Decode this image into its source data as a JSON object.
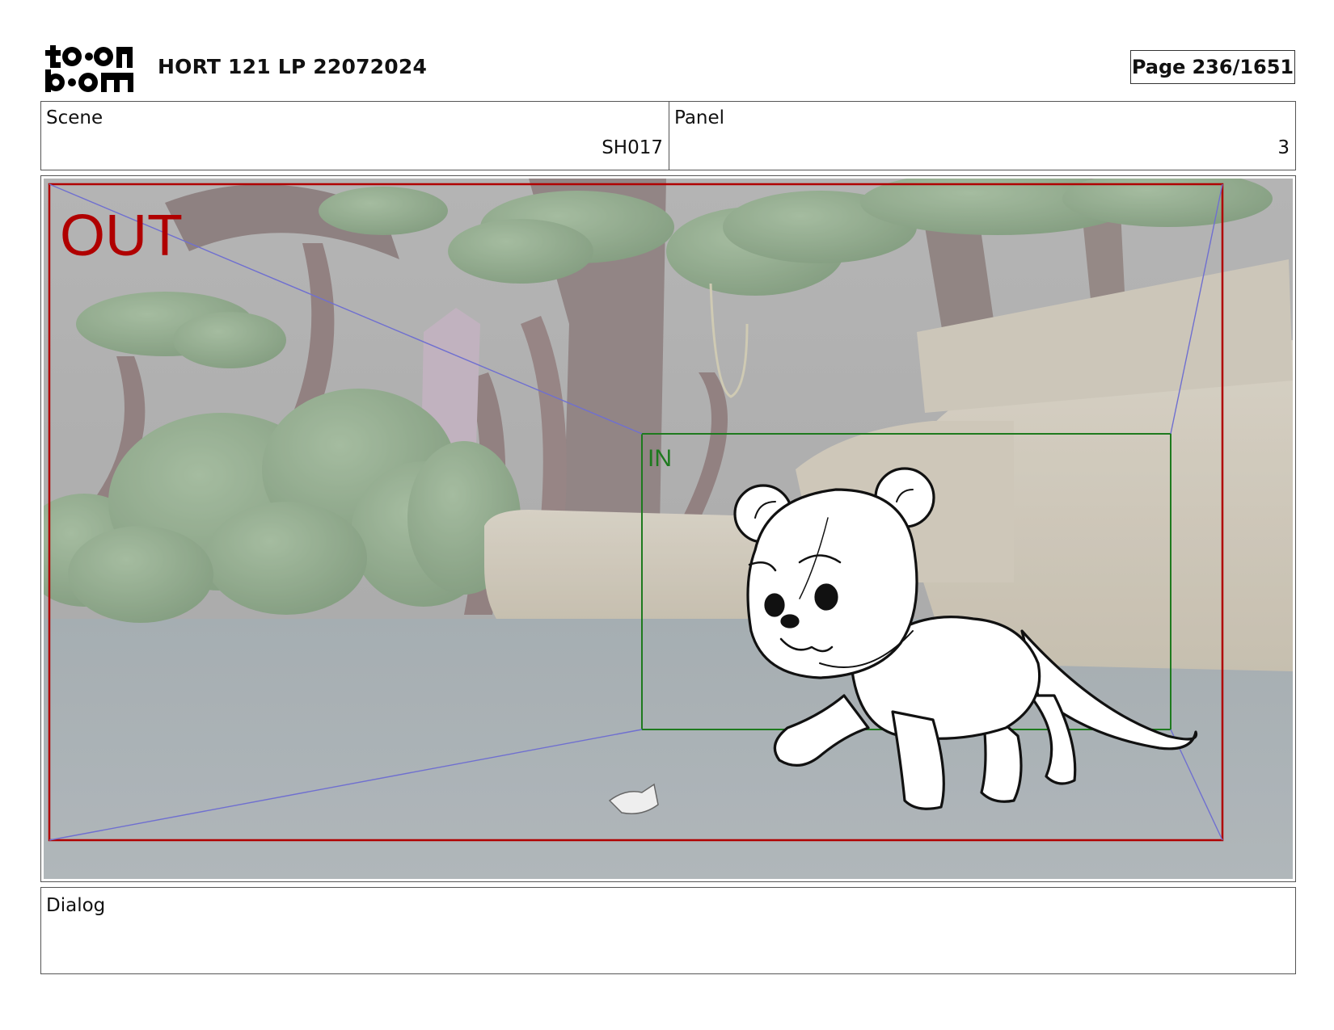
{
  "header": {
    "logo_text": [
      "toon",
      "boom"
    ],
    "title": "HORT 121 LP 22072024",
    "page_label": "Page",
    "page_value": "236/1651"
  },
  "info": {
    "scene_label": "Scene",
    "scene_value": "SH017",
    "panel_label": "Panel",
    "panel_value": "3"
  },
  "frame": {
    "out_label": "OUT",
    "in_label": "IN",
    "out_color": "#b00000",
    "in_color": "#1e7a1e",
    "camera_path_color": "#6f6fd0"
  },
  "dialog": {
    "label": "Dialog",
    "text": ""
  }
}
